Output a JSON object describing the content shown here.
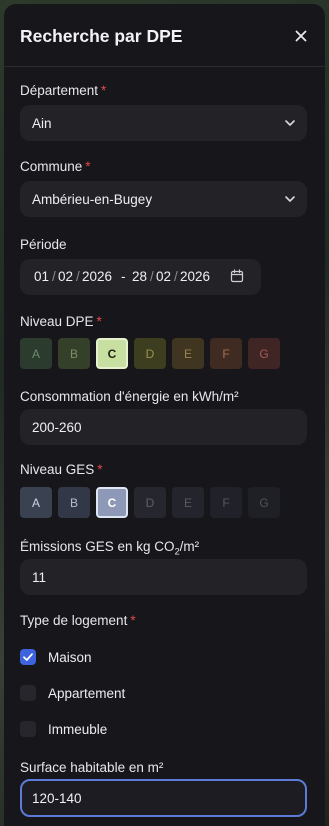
{
  "header": {
    "title": "Recherche par DPE",
    "close_icon": "close-icon"
  },
  "departement": {
    "label": "Département",
    "required": "*",
    "value": "Ain"
  },
  "commune": {
    "label": "Commune",
    "required": "*",
    "value": "Ambérieu-en-Bugey"
  },
  "periode": {
    "label": "Période",
    "start": {
      "day": "01",
      "month": "02",
      "year": "2026"
    },
    "separator": "-",
    "end": {
      "day": "28",
      "month": "02",
      "year": "2026"
    },
    "icon": "calendar-icon"
  },
  "niveau_dpe": {
    "label": "Niveau DPE",
    "required": "*",
    "selected": "C",
    "letters": [
      "A",
      "B",
      "C",
      "D",
      "E",
      "F",
      "G"
    ],
    "colors": {
      "A": {
        "bg": "#2b3b2e",
        "fg": "#6f8a70"
      },
      "B": {
        "bg": "#34402a",
        "fg": "#7d8d66"
      },
      "C": {
        "bg": "#c7dfa0",
        "fg": "#1c2414",
        "border": "#e6f2cf"
      },
      "D": {
        "bg": "#3d3d1f",
        "fg": "#9a9550"
      },
      "E": {
        "bg": "#3f3520",
        "fg": "#9c8450"
      },
      "F": {
        "bg": "#3f2b22",
        "fg": "#a36f58"
      },
      "G": {
        "bg": "#402525",
        "fg": "#a65a55"
      }
    }
  },
  "consommation": {
    "label": "Consommation d'énergie en kWh/m²",
    "value": "200-260"
  },
  "niveau_ges": {
    "label": "Niveau GES",
    "required": "*",
    "selected": "C",
    "letters": [
      "A",
      "B",
      "C",
      "D",
      "E",
      "F",
      "G"
    ],
    "colors": {
      "A": {
        "bg": "#3a4150",
        "fg": "#cfd3dc"
      },
      "B": {
        "bg": "#323848",
        "fg": "#b6bccb"
      },
      "C": {
        "bg": "#8d99b6",
        "fg": "#ffffff",
        "border": "#dfe5f3"
      },
      "D": {
        "bg": "#26262f",
        "fg": "#5e5e6b"
      },
      "E": {
        "bg": "#24242d",
        "fg": "#5a5a66"
      },
      "F": {
        "bg": "#212129",
        "fg": "#555561"
      },
      "G": {
        "bg": "#1f1f26",
        "fg": "#51515c"
      }
    }
  },
  "emissions": {
    "label_prefix": "Émissions GES en kg CO",
    "label_sub": "2",
    "label_suffix": "/m²",
    "value": "11"
  },
  "type_logement": {
    "label": "Type de logement",
    "required": "*",
    "options": [
      {
        "label": "Maison",
        "checked": true
      },
      {
        "label": "Appartement",
        "checked": false
      },
      {
        "label": "Immeuble",
        "checked": false
      }
    ]
  },
  "surface": {
    "label": "Surface habitable en m²",
    "value": "120-140"
  }
}
